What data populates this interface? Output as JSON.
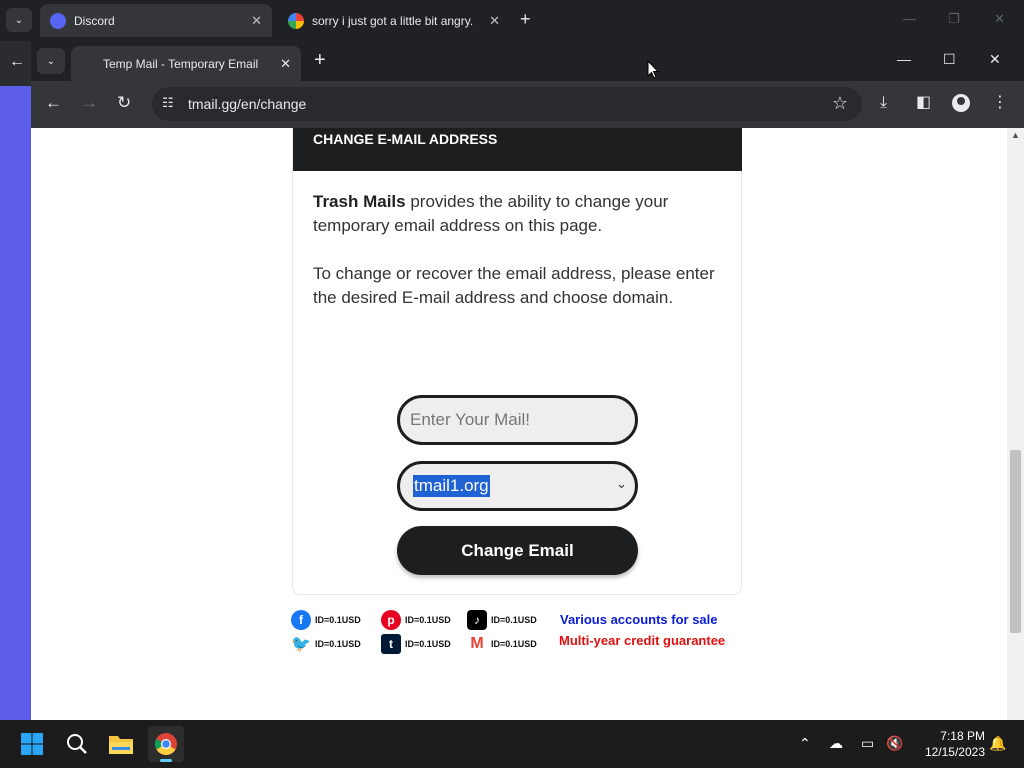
{
  "back_window": {
    "tabs": [
      {
        "title": "Discord",
        "close": "✕"
      },
      {
        "title": "sorry i just got a little bit angry.",
        "close": "✕"
      }
    ],
    "new_tab": "+"
  },
  "window": {
    "tab": {
      "title": "Temp Mail - Temporary Email",
      "close": "✕"
    },
    "new_tab": "+",
    "url": "tmail.gg/en/change"
  },
  "page": {
    "header": "CHANGE E-MAIL ADDRESS",
    "para1_bold": "Trash Mails",
    "para1_rest": " provides the ability to change your temporary email address on this page.",
    "para2": "To change or recover the email address, please enter the desired E-mail address and choose domain.",
    "mail_placeholder": "Enter Your Mail!",
    "domain_selected": "tmail1.org",
    "change_button": "Change Email"
  },
  "ad": {
    "price": "ID=0.1USD",
    "line1": "Various accounts for sale",
    "line2": "Multi-year credit guarantee",
    "colors": {
      "line1": "#0a1bd6",
      "line2": "#e01010"
    }
  },
  "taskbar": {
    "time": "7:18 PM",
    "date": "12/15/2023"
  }
}
